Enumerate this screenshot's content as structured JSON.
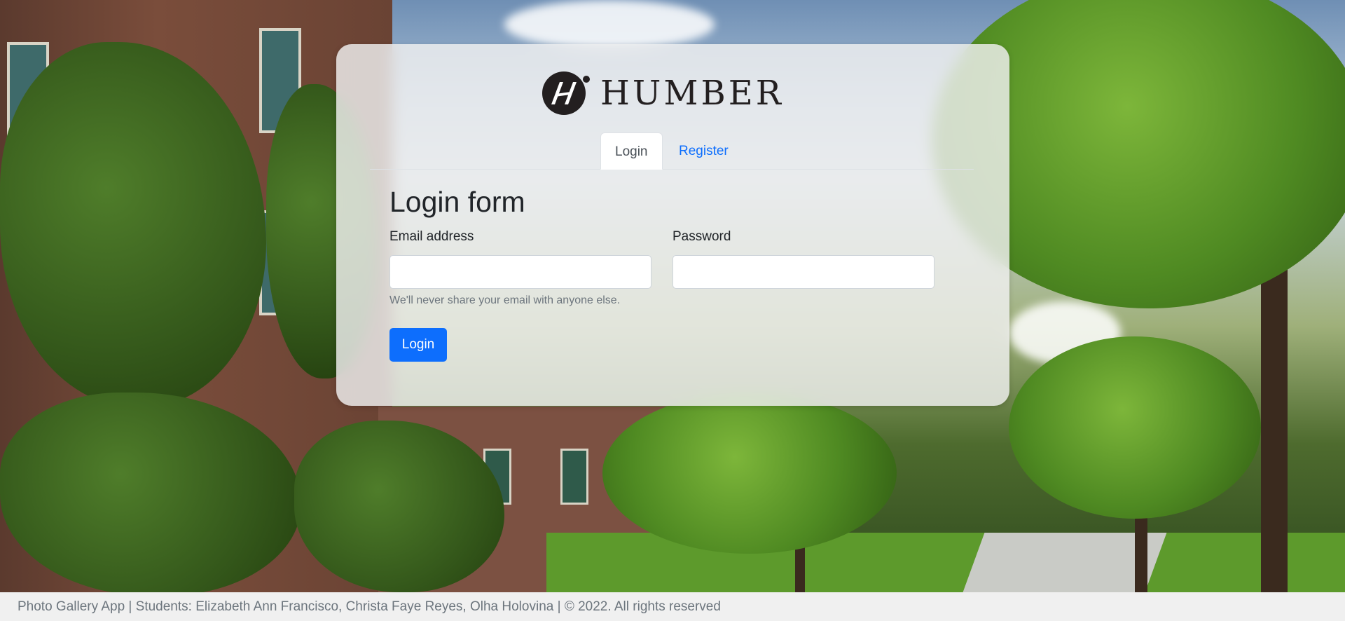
{
  "brand": {
    "logo_text": "HUMBER"
  },
  "tabs": [
    {
      "label": "Login",
      "active": true
    },
    {
      "label": "Register",
      "active": false
    }
  ],
  "form": {
    "title": "Login form",
    "email_label": "Email address",
    "email_value": "",
    "password_label": "Password",
    "password_value": "",
    "email_help": "We'll never share your email with anyone else.",
    "submit_label": "Login"
  },
  "footer": {
    "text": "Photo Gallery App | Students: Elizabeth Ann Francisco, Christa Faye Reyes, Olha Holovina | © 2022. All rights reserved"
  },
  "colors": {
    "primary": "#0d6efd",
    "text": "#212529",
    "muted": "#6c757d",
    "footer_bg": "#f0f0f0"
  }
}
